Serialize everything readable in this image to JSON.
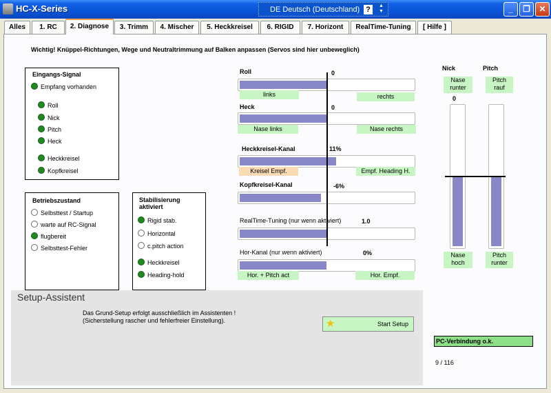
{
  "window": {
    "title": "HC-X-Series",
    "language": "DE Deutsch (Deutschland)",
    "help_label": "?",
    "minimize": "_",
    "maximize": "❐",
    "close": "✕"
  },
  "tabs": [
    "Alles",
    "1. RC",
    "2. Diagnose",
    "3. Trimm",
    "4. Mischer",
    "5. Heckkreisel",
    "6. RIGID",
    "7. Horizont",
    "RealTime-Tuning",
    "[ Hilfe ]"
  ],
  "notice": "Wichtig! Knüppel-Richtungen, Wege und Neutraltrimmung auf Balken anpassen (Servos sind hier unbeweglich)",
  "eingang": {
    "title": "Eingangs-Signal",
    "items": [
      {
        "label": "Empfang vorhanden",
        "on": true
      },
      {
        "label": "Roll",
        "on": true
      },
      {
        "label": "Nick",
        "on": true
      },
      {
        "label": "Pitch",
        "on": true
      },
      {
        "label": "Heck",
        "on": true
      },
      {
        "label": "Heckkreisel",
        "on": true
      },
      {
        "label": "Kopfkreisel",
        "on": true
      }
    ]
  },
  "betrieb": {
    "title": "Betriebszustand",
    "items": [
      {
        "label": "Selbsttest / Startup",
        "on": false
      },
      {
        "label": "warte auf RC-Signal",
        "on": false
      },
      {
        "label": "flugbereit",
        "on": true
      },
      {
        "label": "Selbsttest-Fehler",
        "on": false
      }
    ]
  },
  "stabil": {
    "title_line1": "Stabilisierung",
    "title_line2": "aktiviert",
    "items": [
      {
        "label": "Rigid stab.",
        "on": true
      },
      {
        "label": "Horizontal",
        "on": false
      },
      {
        "label": "c.pitch action",
        "on": false
      },
      {
        "label": "Heckkreisel",
        "on": true
      },
      {
        "label": "Heading-hold",
        "on": true
      }
    ]
  },
  "channels": {
    "roll": {
      "label": "Roll",
      "value": "0",
      "fill": 0.0,
      "left": "links",
      "right": "rechts"
    },
    "heck": {
      "label": "Heck",
      "value": "0",
      "fill": 0.0,
      "left": "Nase links",
      "right": "Nase rechts"
    },
    "heckkreisel": {
      "label": "Heckkreisel-Kanal",
      "value": "11%",
      "fill": 0.11,
      "left": "Kreisel Empf.",
      "right": "Empf. Heading H."
    },
    "kopfkreisel": {
      "label": "Kopfkreisel-Kanal",
      "value": "-6%",
      "fill": -0.06
    },
    "realtime": {
      "label": "RealTime-Tuning  (nur wenn aktiviert)",
      "value": "1.0"
    },
    "horkanal": {
      "label": "Hor-Kanal (nur wenn aktiviert)",
      "value": "0%",
      "fill": 0.0,
      "left": "Hor. + Pitch act",
      "right": "Hor. Empf."
    }
  },
  "nick": {
    "label": "Nick",
    "top": "Nase\nrunter",
    "value": "0",
    "bottom": "Nase\nhoch"
  },
  "pitch": {
    "label": "Pitch",
    "top": "Pitch\nrauf",
    "bottom": "Pitch\nrunter"
  },
  "setup": {
    "title": "Setup-Assistent",
    "text_line1": "Das Grund-Setup erfolgt ausschließlich im Assistenten !",
    "text_line2": "(Sicherstellung rascher und fehlerfreier Einstellung).",
    "button": "Start Setup"
  },
  "status": "PC-Verbindung o.k.",
  "page_counter": "9 / 116",
  "colors": {
    "bar_fill": "#8888c8",
    "green_label": "#c8f5c4",
    "orange_label": "#fadbb4",
    "status_ok": "#8ee088",
    "led_on": "#1f8a1f"
  }
}
